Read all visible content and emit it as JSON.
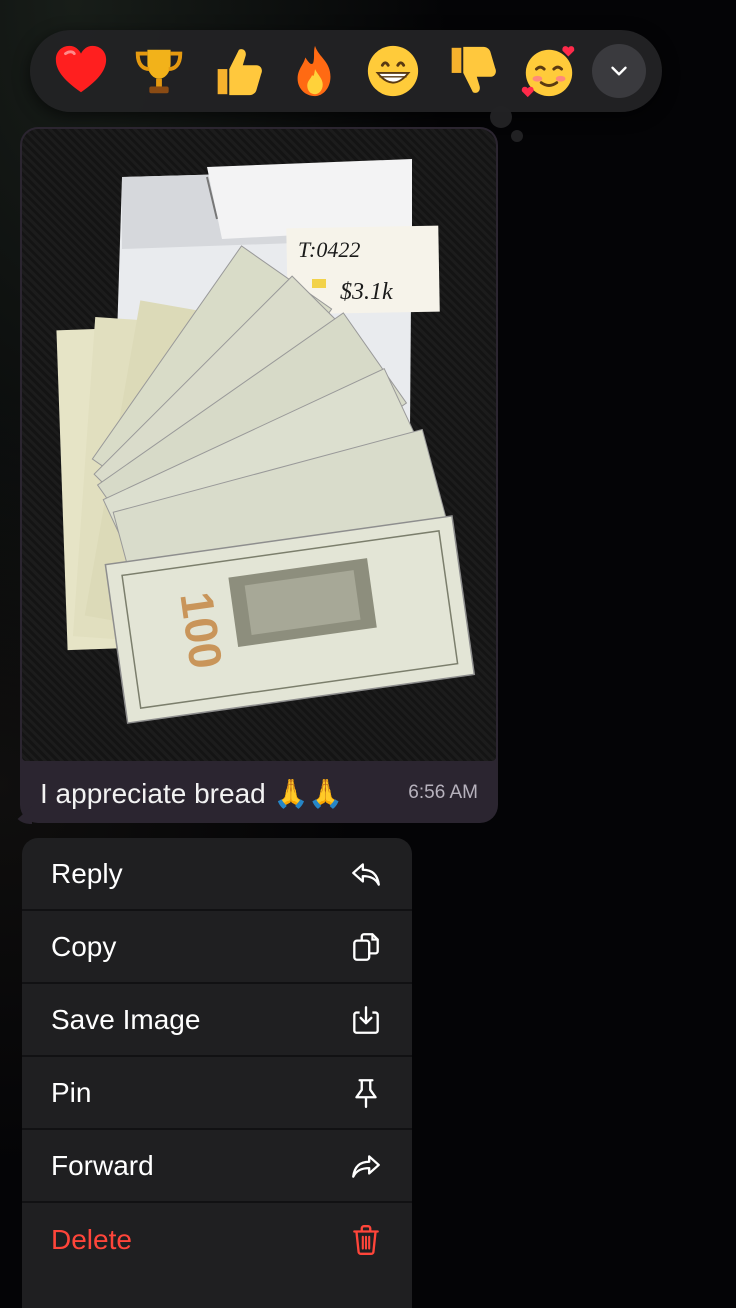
{
  "reactions": {
    "items": [
      {
        "name": "heart",
        "glyph": "❤"
      },
      {
        "name": "trophy",
        "glyph": "🏆"
      },
      {
        "name": "thumbs-up",
        "glyph": "👍"
      },
      {
        "name": "fire",
        "glyph": "🔥"
      },
      {
        "name": "grinning-face",
        "glyph": "😁"
      },
      {
        "name": "thumbs-down",
        "glyph": "👎"
      },
      {
        "name": "smiling-face-with-hearts",
        "glyph": "🥰"
      }
    ],
    "expand_icon": "chevron-down-icon"
  },
  "message": {
    "photo_note": {
      "line1": "T:0422",
      "line2": "$3.1k"
    },
    "bill_denomination": "100",
    "caption": "I appreciate bread 🙏🙏",
    "time": "6:56 AM"
  },
  "context_menu": {
    "items": [
      {
        "label": "Reply",
        "icon": "reply-icon"
      },
      {
        "label": "Copy",
        "icon": "copy-icon"
      },
      {
        "label": "Save Image",
        "icon": "save-image-icon"
      },
      {
        "label": "Pin",
        "icon": "pin-icon"
      },
      {
        "label": "Forward",
        "icon": "forward-icon"
      },
      {
        "label": "Delete",
        "icon": "trash-icon"
      }
    ]
  },
  "colors": {
    "background": "#050507",
    "bubble": "#2b2530",
    "menu": "#1f1f21",
    "delete": "#ff453a"
  }
}
